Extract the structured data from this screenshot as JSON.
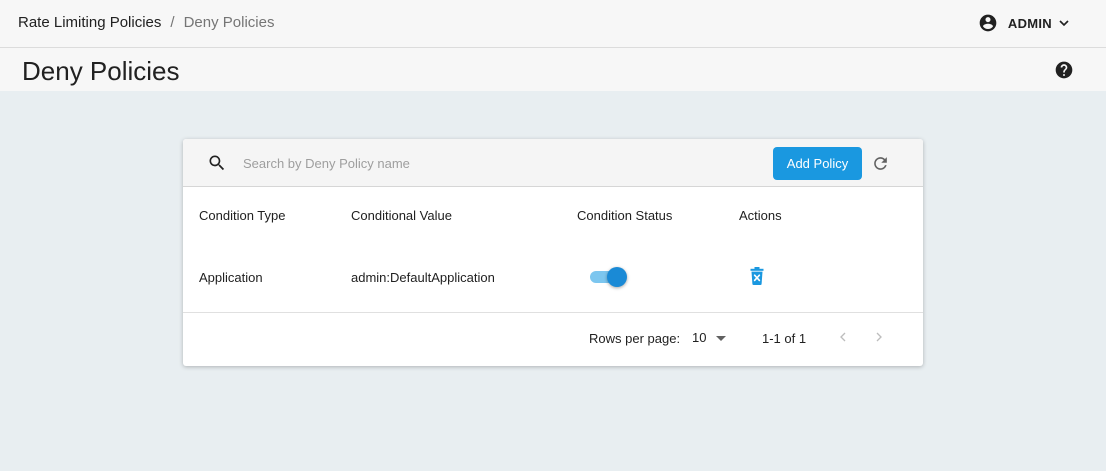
{
  "breadcrumb": {
    "parent": "Rate Limiting Policies",
    "separator": "/",
    "current": "Deny Policies"
  },
  "header": {
    "user_name": "ADMIN",
    "user_icon": "account-circle-icon",
    "help_icon": "help-circle-icon"
  },
  "page": {
    "title": "Deny Policies"
  },
  "toolbar": {
    "search_placeholder": "Search by Deny Policy name",
    "search_value": "",
    "add_label": "Add Policy",
    "refresh_icon": "refresh-icon"
  },
  "table": {
    "columns": [
      "Condition Type",
      "Conditional Value",
      "Condition Status",
      "Actions"
    ],
    "rows": [
      {
        "condition_type": "Application",
        "conditional_value": "admin:DefaultApplication",
        "condition_status": true,
        "action_icon": "delete-icon"
      }
    ]
  },
  "pagination": {
    "rows_per_page_label": "Rows per page:",
    "rows_per_page": "10",
    "range": "1-1 of 1"
  },
  "colors": {
    "accent": "#1a98e0",
    "toggle_track": "#7cc6ef",
    "background": "#e8eef1"
  }
}
